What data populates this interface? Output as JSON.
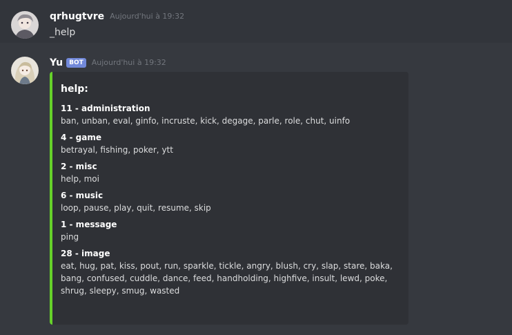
{
  "messages": [
    {
      "username": "qrhugtvre",
      "timestamp": "Aujourd'hui à 19:32",
      "content": "_help"
    },
    {
      "username": "Yu",
      "bot_tag": "BOT",
      "timestamp": "Aujourd'hui à 19:32",
      "embed": {
        "title": "help:",
        "accent_color": "#66d12a",
        "fields": [
          {
            "name": "11 - administration",
            "value": "ban, unban, eval, ginfo, incruste, kick, degage, parle, role, chut, uinfo"
          },
          {
            "name": "4 - game",
            "value": "betrayal, fishing, poker, ytt"
          },
          {
            "name": "2 - misc",
            "value": "help, moi"
          },
          {
            "name": "6 - music",
            "value": "loop, pause, play, quit, resume, skip"
          },
          {
            "name": "1 - message",
            "value": "ping"
          },
          {
            "name": "28 - image",
            "value": "eat, hug, pat, kiss, pout, run, sparkle, tickle, angry, blush, cry, slap, stare, baka, bang, confused, cuddle, dance, feed, handholding, highfive, insult, lewd, poke, shrug, sleepy, smug, wasted"
          }
        ]
      }
    }
  ]
}
